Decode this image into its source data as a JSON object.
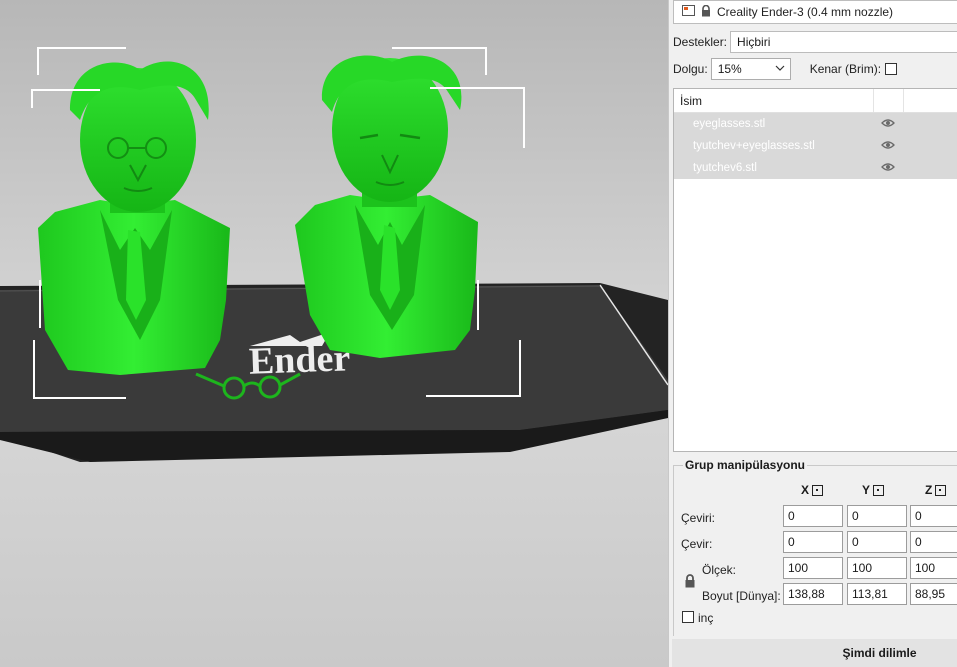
{
  "printer": {
    "name": "Creality Ender-3 (0.4 mm nozzle)"
  },
  "settings": {
    "supports_label": "Destekler:",
    "supports_value": "Hiçbiri",
    "infill_label": "Dolgu:",
    "infill_value": "15%",
    "brim_label": "Kenar (Brim):",
    "brim_checked": false
  },
  "object_list": {
    "header_name": "İsim",
    "items": [
      {
        "name": "eyeglasses.stl"
      },
      {
        "name": "tyutchev+eyeglasses.stl"
      },
      {
        "name": "tyutchev6.stl"
      }
    ]
  },
  "group_manipulation": {
    "title": "Grup manipülasyonu",
    "axes": [
      "X",
      "Y",
      "Z"
    ],
    "rows": [
      {
        "label": "Çeviri:",
        "values": [
          "0",
          "0",
          "0"
        ]
      },
      {
        "label": "Çevir:",
        "values": [
          "0",
          "0",
          "0"
        ]
      },
      {
        "label": "Ölçek:",
        "values": [
          "100",
          "100",
          "100"
        ]
      },
      {
        "label": "Boyut [Dünya]:",
        "values": [
          "138,88",
          "113,81",
          "88,95"
        ]
      }
    ],
    "inch_label": "inç"
  },
  "slice_button": {
    "label": "Şimdi dilimle"
  },
  "bed": {
    "logo_text": "Ender"
  },
  "colors": {
    "model_green": "#22dd22",
    "bed_dark": "#2b2b2b",
    "panel_bg": "#f0f0f0",
    "list_selected": "#d9d9d9"
  }
}
